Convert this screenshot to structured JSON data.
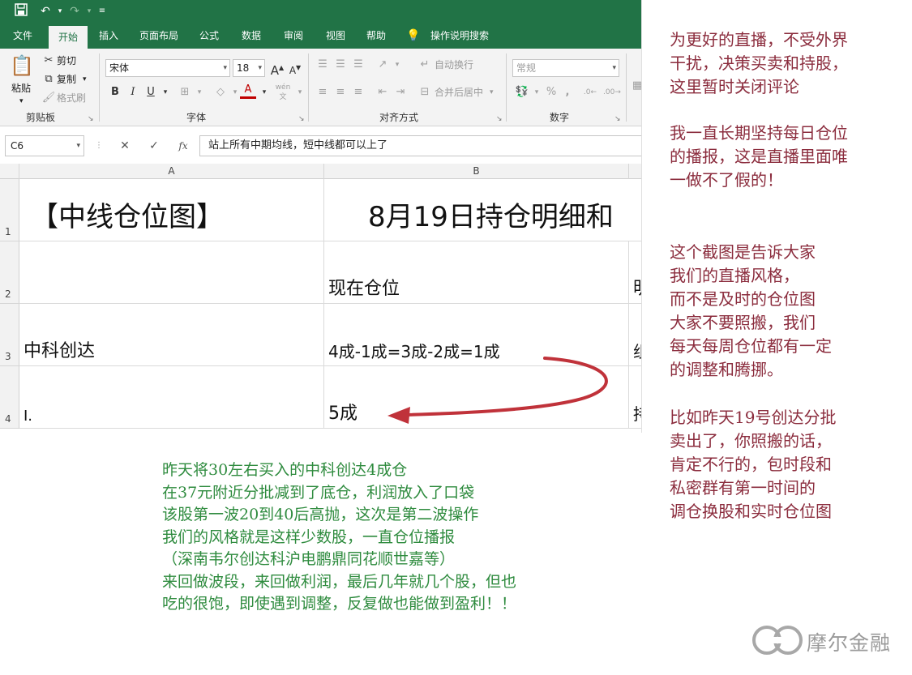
{
  "excel": {
    "menu_tabs": [
      "文件",
      "开始",
      "插入",
      "页面布局",
      "公式",
      "数据",
      "审阅",
      "视图",
      "帮助"
    ],
    "tell_me": "操作说明搜索",
    "ribbon": {
      "clipboard": {
        "paste": "粘贴",
        "cut": "剪切",
        "copy": "复制",
        "format_painter": "格式刷",
        "label": "剪贴板"
      },
      "font": {
        "name": "宋体",
        "size": "18",
        "grow": "A",
        "shrink": "A",
        "bold": "B",
        "italic": "I",
        "underline": "U",
        "color_letter": "A",
        "phonetic": "wén",
        "label": "字体"
      },
      "alignment": {
        "wrap_text": "自动换行",
        "merge_center": "合并后居中",
        "label": "对齐方式"
      },
      "number": {
        "format": "常规",
        "percent": "%",
        "comma": ",",
        "label": "数字"
      }
    },
    "formula_bar": {
      "name_box": "C6",
      "cancel": "✕",
      "enter": "✓",
      "fx": "fx",
      "content": "站上所有中期均线，短中线都可以上了"
    },
    "columns": [
      "A",
      "B"
    ],
    "rows": [
      {
        "num": "1",
        "a": "【中线仓位图】",
        "b": "8月19日持仓明细和"
      },
      {
        "num": "2",
        "a": "",
        "b": "现在仓位",
        "c": "明"
      },
      {
        "num": "3",
        "a": "中科创达",
        "b": "4成-1成=3成-2成=1成",
        "c": "组"
      },
      {
        "num": "4",
        "a": "I.",
        "b": "5成",
        "c": "持"
      }
    ],
    "accent_color": "#217346"
  },
  "annotations": {
    "right": [
      "为更好的直播，不受外界\n干扰，决策买卖和持股，\n这里暂时关闭评论",
      "我一直长期坚持每日仓位\n的播报，这是直播里面唯\n一做不了假的！",
      "这个截图是告诉大家\n我们的直播风格，\n而不是及时的仓位图\n大家不要照搬，我们\n每天每周仓位都有一定\n的调整和腾挪。",
      "比如昨天19号创达分批\n卖出了，你照搬的话，\n肯定不行的，包时段和\n私密群有第一时间的\n调仓换股和实时仓位图"
    ],
    "bottom": "昨天将30左右买入的中科创达4成仓\n在37元附近分批减到了底仓，利润放入了口袋\n该股第一波20到40后高抛，这次是第二波操作\n我们的风格就是这样少数股，一直仓位播报\n（深南韦尔创达科沪电鹏鼎同花顺世嘉等）\n来回做波段，来回做利润，最后几年就几个股，但也\n吃的很饱，即使遇到调整，反复做也能做到盈利！！",
    "right_color": "#8b2c3d",
    "bottom_color": "#2e8b3e",
    "arrow_color": "#c0323a"
  },
  "watermark": {
    "text": "摩尔金融"
  }
}
